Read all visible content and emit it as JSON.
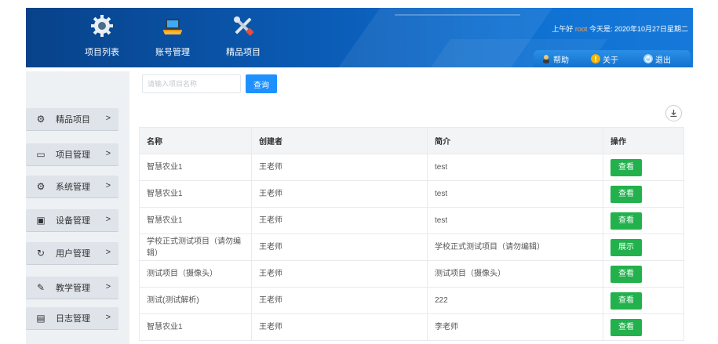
{
  "colors": {
    "header_blue": "#0b5cb6",
    "action_bar": "#1b7fdc",
    "search_button": "#1e90ff",
    "view_button": "#22b14c",
    "sidebar_bg": "#eef1f4",
    "username": "#f4a261"
  },
  "nav": [
    {
      "label": "项目列表",
      "icon": "gear-icon"
    },
    {
      "label": "账号管理",
      "icon": "laptop-icon"
    },
    {
      "label": "精品项目",
      "icon": "tools-icon"
    }
  ],
  "header": {
    "greeting": "上午好",
    "username": "root",
    "date": "今天是: 2020年10月27日星期二",
    "actions": [
      {
        "label": "帮助",
        "icon": "help-user-icon"
      },
      {
        "label": "关于",
        "icon": "info-icon"
      },
      {
        "label": "退出",
        "icon": "power-icon"
      }
    ]
  },
  "sidebar": {
    "items": [
      {
        "label": "精品项目",
        "icon": "gear-icon"
      },
      {
        "label": "项目管理",
        "icon": "window-icon"
      },
      {
        "label": "系统管理",
        "icon": "gear-icon"
      },
      {
        "label": "设备管理",
        "icon": "monitor-icon"
      },
      {
        "label": "用户管理",
        "icon": "refresh-icon"
      },
      {
        "label": "教学管理",
        "icon": "pencil-icon"
      },
      {
        "label": "日志管理",
        "icon": "log-icon"
      }
    ],
    "arrow": ">"
  },
  "search": {
    "placeholder": "请输入项目名称",
    "button_label": "查询"
  },
  "table": {
    "columns": [
      "名称",
      "创建者",
      "简介",
      "操作"
    ],
    "rows": [
      {
        "name": "智慧农业1",
        "creator": "王老师",
        "desc": "test",
        "action": "查看"
      },
      {
        "name": "智慧农业1",
        "creator": "王老师",
        "desc": "test",
        "action": "查看"
      },
      {
        "name": "智慧农业1",
        "creator": "王老师",
        "desc": "test",
        "action": "查看"
      },
      {
        "name": "学校正式测试项目（请勿编辑）",
        "creator": "王老师",
        "desc": "学校正式测试项目（请勿编辑）",
        "action": "展示"
      },
      {
        "name": "测试项目（摄像头）",
        "creator": "王老师",
        "desc": "测试项目（摄像头）",
        "action": "查看"
      },
      {
        "name": "测试(测试解析)",
        "creator": "王老师",
        "desc": "222",
        "action": "查看"
      },
      {
        "name": "智慧农业1",
        "creator": "王老师",
        "desc": "李老师",
        "action": "查看"
      }
    ]
  }
}
